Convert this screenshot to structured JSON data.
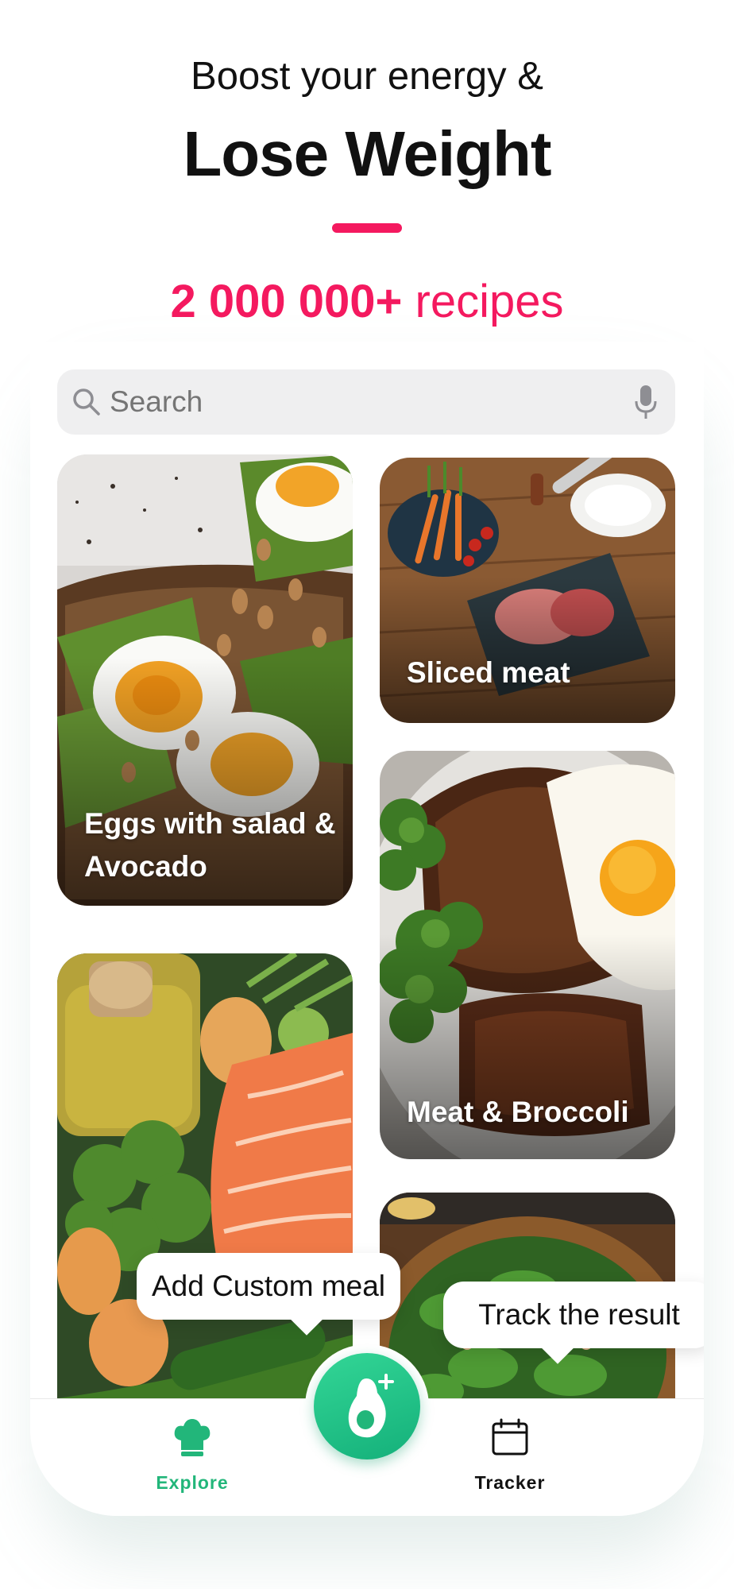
{
  "headline": {
    "subtitle": "Boost your energy &",
    "title": "Lose Weight",
    "recipes_count": "2 000 000+",
    "recipes_word": "recipes"
  },
  "search": {
    "placeholder": "Search",
    "search_icon": "magnifier-icon",
    "voice_icon": "microphone-icon"
  },
  "cards": [
    {
      "title": "Eggs with salad & Avocado"
    },
    {
      "title": "Sliced meat"
    },
    {
      "title": "Meat & Broccoli"
    }
  ],
  "tooltips": {
    "add_custom_meal": "Add Custom meal",
    "track_result": "Track the result"
  },
  "tabbar": {
    "explore": {
      "label": "Explore",
      "icon": "chef-hat-icon",
      "active": true
    },
    "tracker": {
      "label": "Tracker",
      "icon": "calendar-icon",
      "active": false
    },
    "add_button_icon": "avocado-plus-icon"
  },
  "colors": {
    "accent": "#f4195f",
    "brand_green": "#22b67a"
  }
}
